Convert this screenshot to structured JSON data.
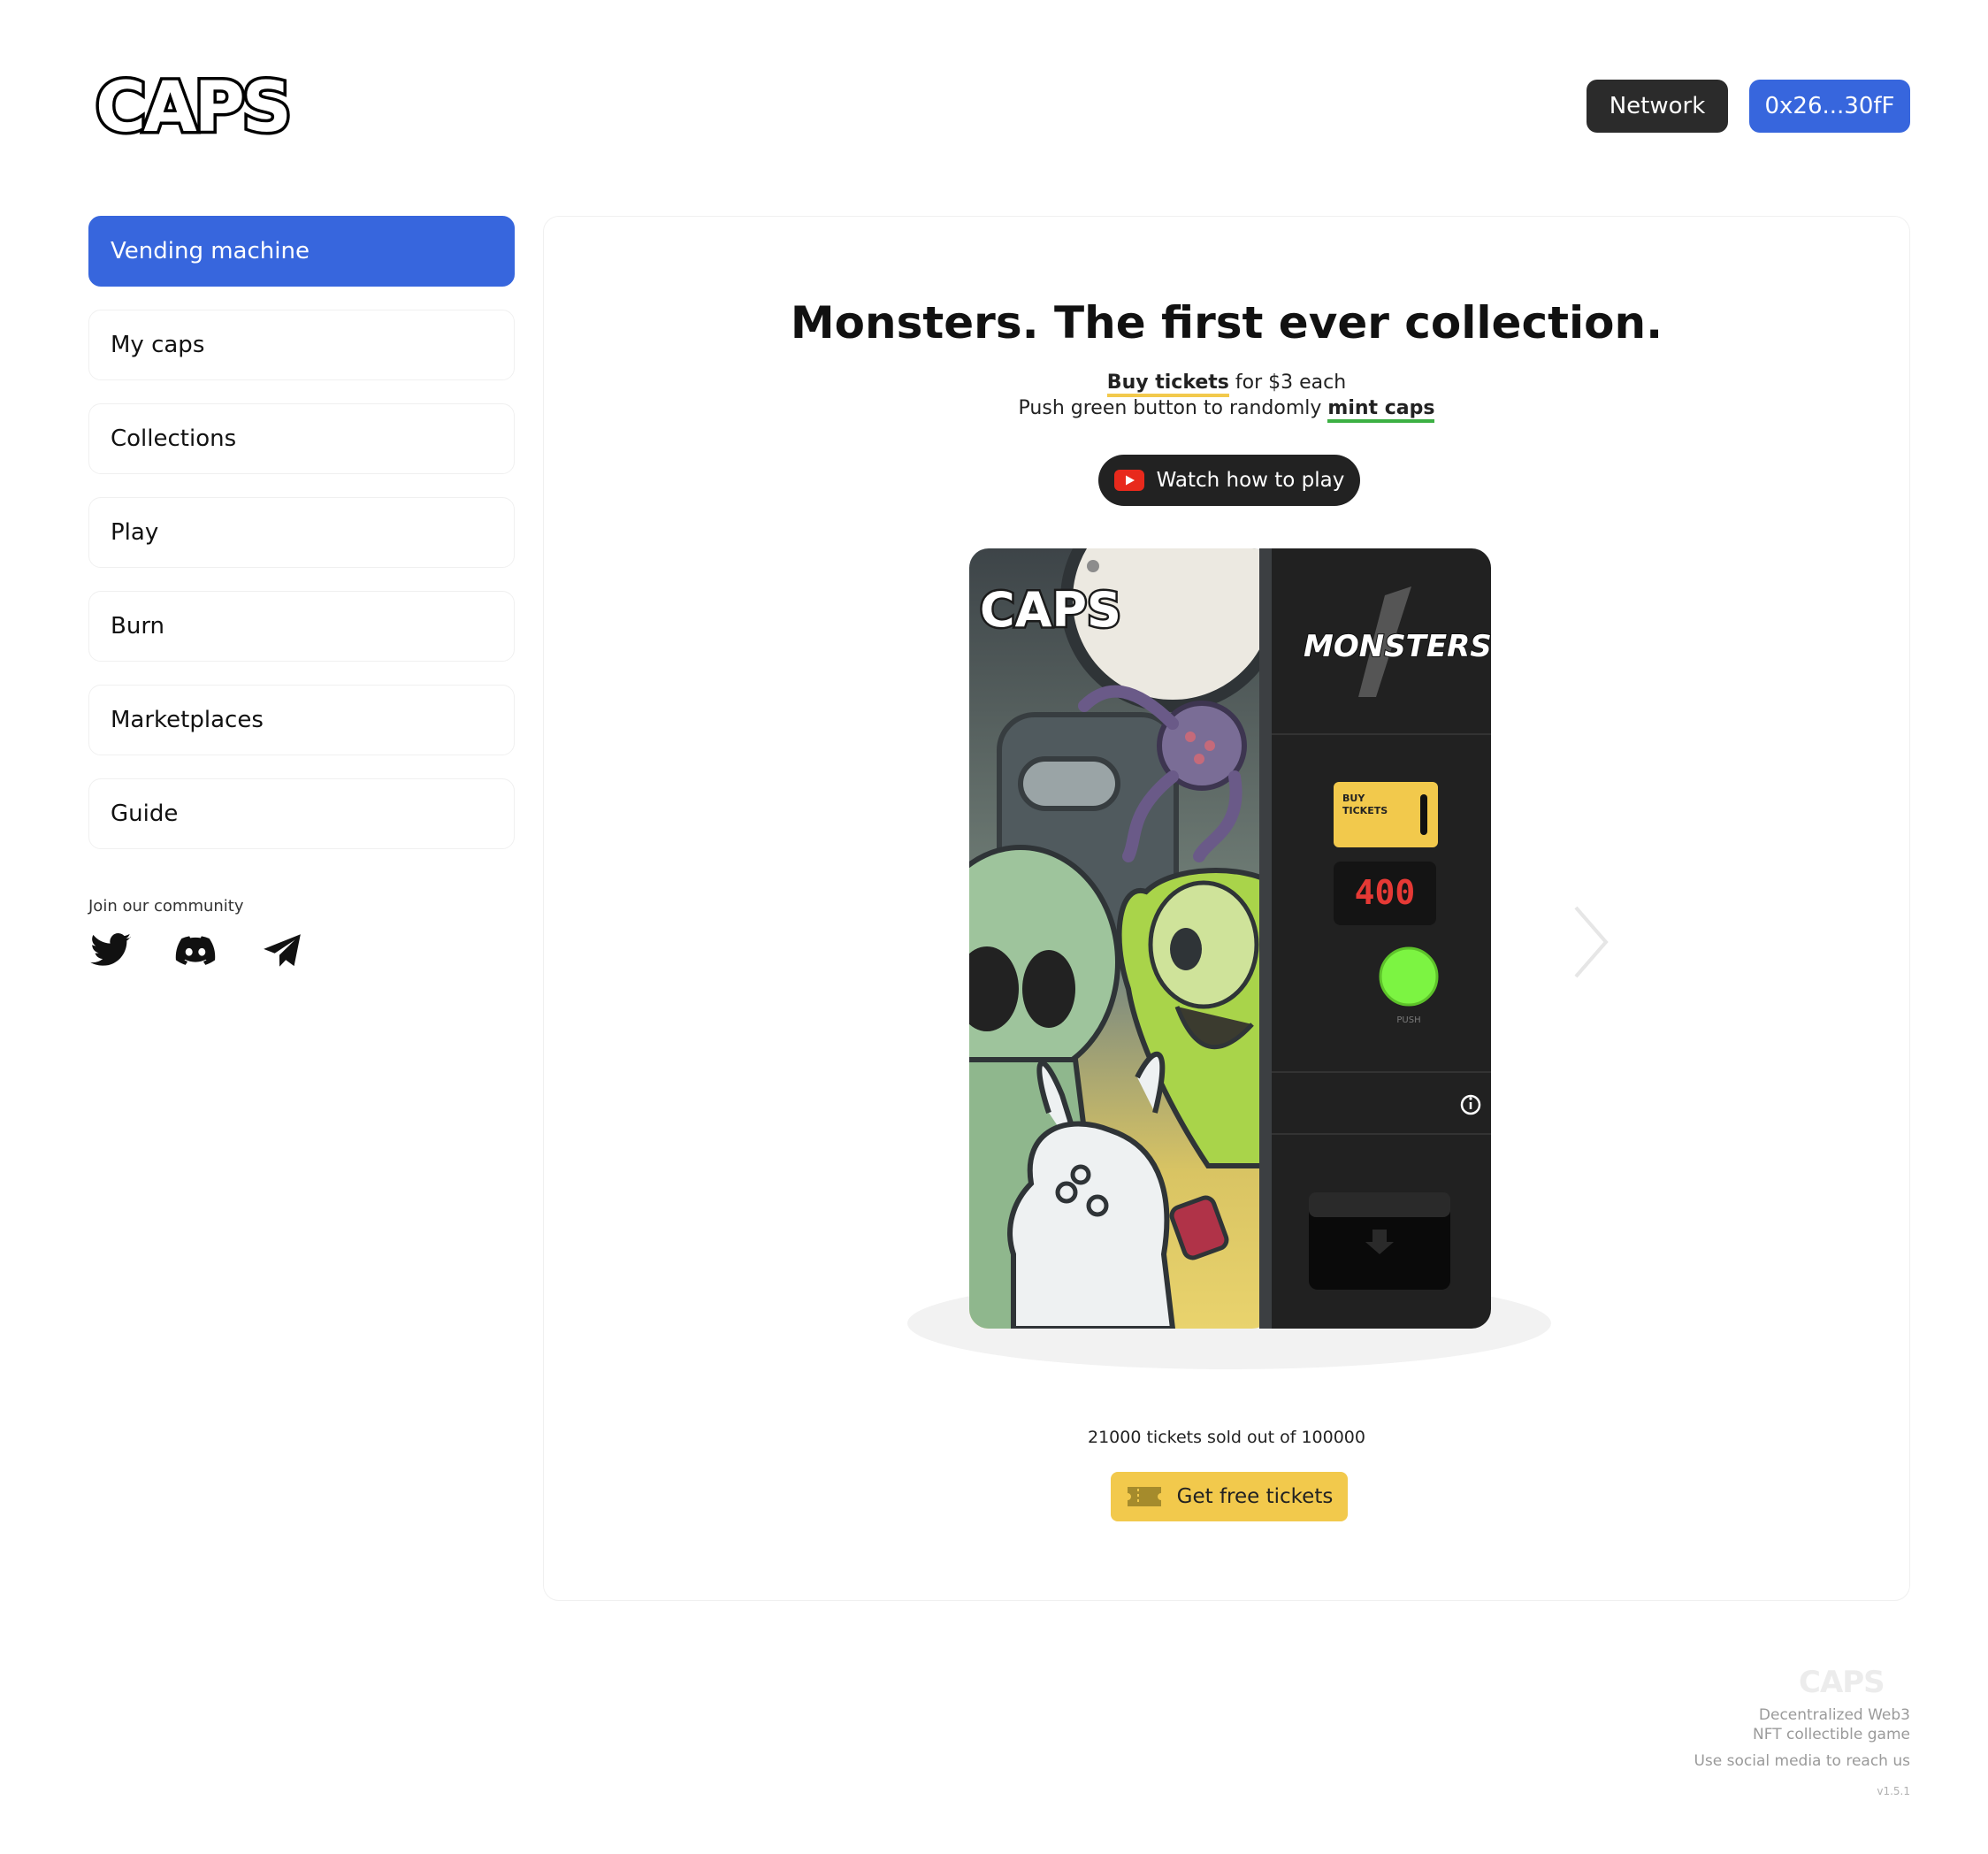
{
  "header": {
    "logo_text": "CAPS",
    "network_label": "Network",
    "wallet_label": "0x26...30fF"
  },
  "sidebar": {
    "items": [
      {
        "label": "Vending machine",
        "active": true
      },
      {
        "label": "My caps"
      },
      {
        "label": "Collections"
      },
      {
        "label": "Play"
      },
      {
        "label": "Burn"
      },
      {
        "label": "Marketplaces"
      },
      {
        "label": "Guide"
      }
    ],
    "community_label": "Join our community",
    "social_icons": [
      "twitter-icon",
      "discord-icon",
      "telegram-icon"
    ]
  },
  "main": {
    "title": "Monsters. The first ever collection.",
    "line1": {
      "link": "Buy tickets",
      "rest": " for $3 each"
    },
    "line2": {
      "prefix": "Push green button to randomly ",
      "link": "mint caps"
    },
    "watch_label": "Watch how to play",
    "machine": {
      "brand": "CAPS",
      "collection": "MONSTERS",
      "ticket_slot_label_1": "BUY",
      "ticket_slot_label_2": "TICKETS",
      "counter": "400",
      "push_label": "PUSH"
    },
    "tickets_sold": "21000 tickets sold out of 100000",
    "free_tickets_label": "Get free tickets"
  },
  "footer": {
    "logo_text": "CAPS",
    "tagline_1": "Decentralized Web3",
    "tagline_2": "NFT collectible game",
    "contact": "Use social media to reach us",
    "version": "v1.5.1"
  },
  "colors": {
    "accent": "#3766dd",
    "dark_button": "#2b2b2b",
    "yellow": "#f2c94c",
    "push_green": "#7cf442",
    "counter_red": "#e53935"
  }
}
